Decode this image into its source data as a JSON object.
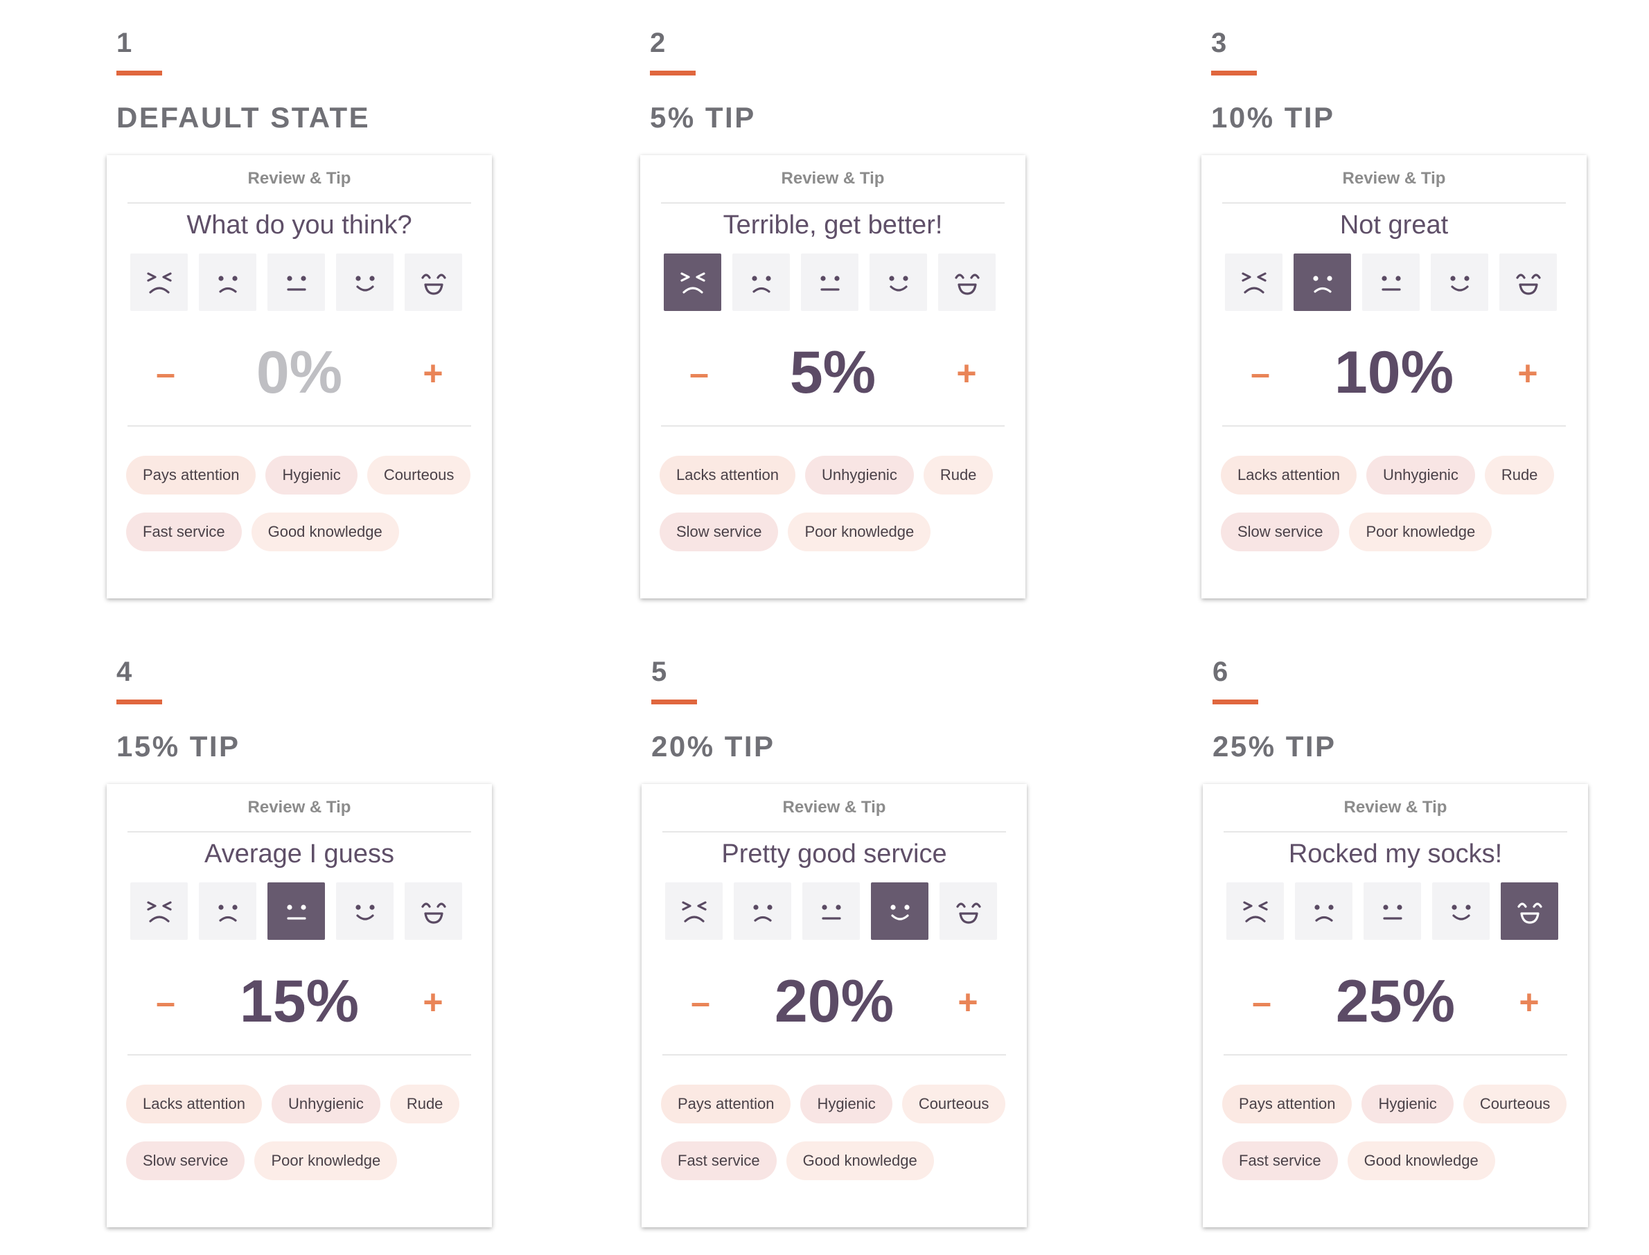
{
  "card_header": "Review & Tip",
  "states": [
    {
      "step": "1",
      "title": "DEFAULT STATE",
      "question": "What do you think?",
      "active_face": null,
      "tip": "0%",
      "tip_muted": true,
      "minus": "–",
      "plus": "+",
      "tags": [
        "Pays attention",
        "Hygienic",
        "Courteous",
        "Fast service",
        "Good knowledge"
      ]
    },
    {
      "step": "2",
      "title": "5% TIP",
      "question": "Terrible, get better!",
      "active_face": 0,
      "tip": "5%",
      "tip_muted": false,
      "minus": "–",
      "plus": "+",
      "tags": [
        "Lacks attention",
        "Unhygienic",
        "Rude",
        "Slow service",
        "Poor knowledge"
      ]
    },
    {
      "step": "3",
      "title": "10% TIP",
      "question": "Not great",
      "active_face": 1,
      "tip": "10%",
      "tip_muted": false,
      "minus": "–",
      "plus": "+",
      "tags": [
        "Lacks attention",
        "Unhygienic",
        "Rude",
        "Slow service",
        "Poor knowledge"
      ]
    },
    {
      "step": "4",
      "title": "15% TIP",
      "question": "Average I guess",
      "active_face": 2,
      "tip": "15%",
      "tip_muted": false,
      "minus": "–",
      "plus": "+",
      "tags": [
        "Lacks attention",
        "Unhygienic",
        "Rude",
        "Slow service",
        "Poor knowledge"
      ]
    },
    {
      "step": "5",
      "title": "20% TIP",
      "question": "Pretty good service",
      "active_face": 3,
      "tip": "20%",
      "tip_muted": false,
      "minus": "–",
      "plus": "+",
      "tags": [
        "Pays attention",
        "Hygienic",
        "Courteous",
        "Fast service",
        "Good knowledge"
      ]
    },
    {
      "step": "6",
      "title": "25% TIP",
      "question": "Rocked my socks!",
      "active_face": 4,
      "tip": "25%",
      "tip_muted": false,
      "minus": "–",
      "plus": "+",
      "tags": [
        "Pays attention",
        "Hygienic",
        "Courteous",
        "Fast service",
        "Good knowledge"
      ]
    }
  ],
  "faces": [
    "squint-face-icon",
    "sad-face-icon",
    "neutral-face-icon",
    "smile-face-icon",
    "grin-face-icon"
  ],
  "colors": {
    "accent": "#e0673e",
    "active_face": "#675a6f",
    "text_primary": "#5c4b66",
    "chip_bg": "#fbe9e3"
  }
}
